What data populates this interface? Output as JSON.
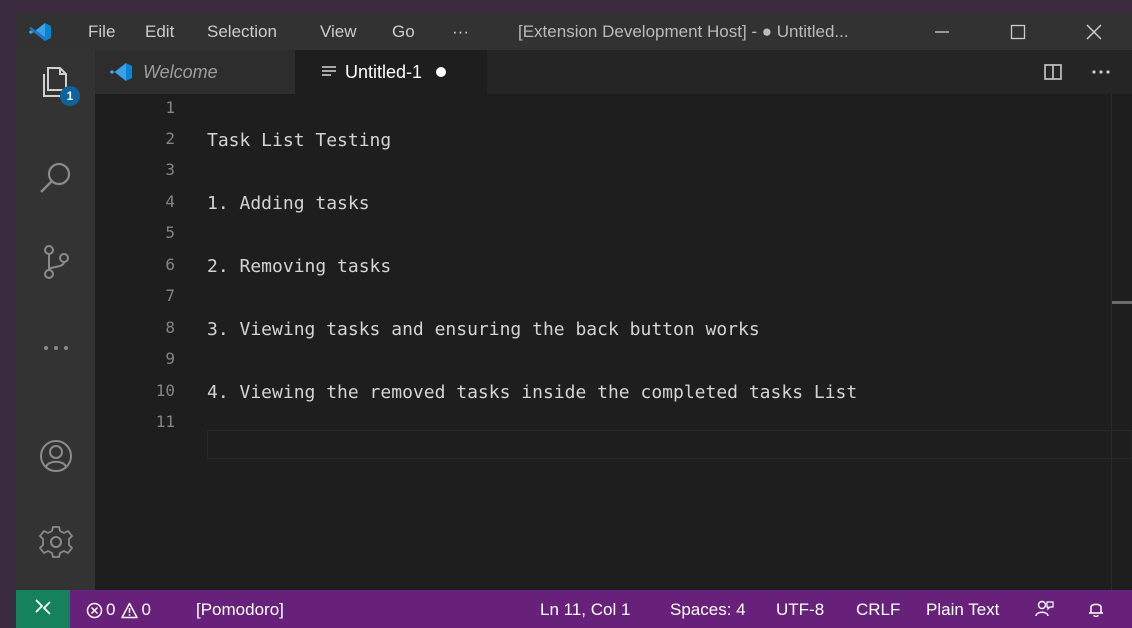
{
  "titlebar": {
    "menu": [
      "File",
      "Edit",
      "Selection",
      "View",
      "Go",
      "···"
    ],
    "title": "[Extension Development Host] - ● Untitled..."
  },
  "activity": {
    "explorer_badge": "1"
  },
  "tabs": [
    {
      "label": "Welcome",
      "active": false
    },
    {
      "label": "Untitled-1",
      "active": true,
      "dirty": true
    }
  ],
  "editor": {
    "lines": [
      {
        "num": "1",
        "text": ""
      },
      {
        "num": "2",
        "text": "Task List Testing"
      },
      {
        "num": "3",
        "text": ""
      },
      {
        "num": "4",
        "text": "1. Adding tasks"
      },
      {
        "num": "5",
        "text": ""
      },
      {
        "num": "6",
        "text": "2. Removing tasks"
      },
      {
        "num": "7",
        "text": ""
      },
      {
        "num": "8",
        "text": "3. Viewing tasks and ensuring the back button works"
      },
      {
        "num": "9",
        "text": ""
      },
      {
        "num": "10",
        "text": "4. Viewing the removed tasks inside the completed tasks List"
      },
      {
        "num": "11",
        "text": ""
      }
    ]
  },
  "statusbar": {
    "errors": "0",
    "warnings": "0",
    "pomodoro": "[Pomodoro]",
    "position": "Ln 11, Col 1",
    "spaces": "Spaces: 4",
    "encoding": "UTF-8",
    "eol": "CRLF",
    "language": "Plain Text"
  },
  "colors": {
    "statusbar": "#68217a",
    "remote": "#16825d",
    "accent": "#0e639c"
  }
}
